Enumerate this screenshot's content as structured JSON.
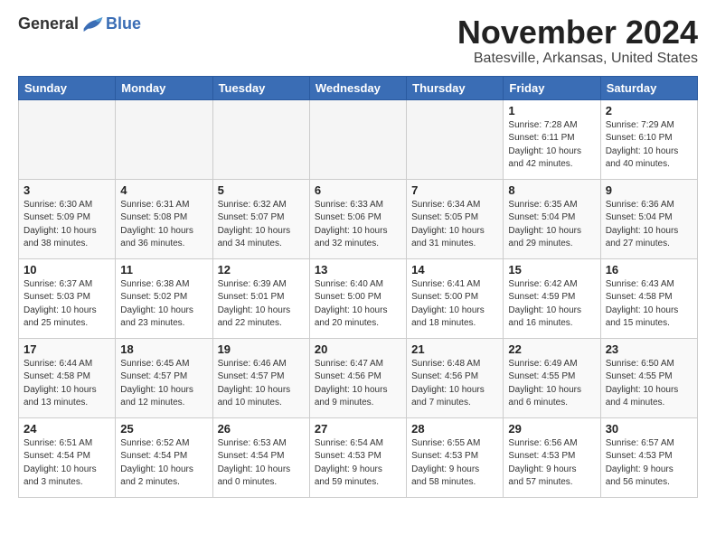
{
  "header": {
    "logo_general": "General",
    "logo_blue": "Blue",
    "month_title": "November 2024",
    "location": "Batesville, Arkansas, United States"
  },
  "days_of_week": [
    "Sunday",
    "Monday",
    "Tuesday",
    "Wednesday",
    "Thursday",
    "Friday",
    "Saturday"
  ],
  "weeks": [
    [
      {
        "day": "",
        "info": "",
        "empty": true
      },
      {
        "day": "",
        "info": "",
        "empty": true
      },
      {
        "day": "",
        "info": "",
        "empty": true
      },
      {
        "day": "",
        "info": "",
        "empty": true
      },
      {
        "day": "",
        "info": "",
        "empty": true
      },
      {
        "day": "1",
        "info": "Sunrise: 7:28 AM\nSunset: 6:11 PM\nDaylight: 10 hours\nand 42 minutes."
      },
      {
        "day": "2",
        "info": "Sunrise: 7:29 AM\nSunset: 6:10 PM\nDaylight: 10 hours\nand 40 minutes."
      }
    ],
    [
      {
        "day": "3",
        "info": "Sunrise: 6:30 AM\nSunset: 5:09 PM\nDaylight: 10 hours\nand 38 minutes."
      },
      {
        "day": "4",
        "info": "Sunrise: 6:31 AM\nSunset: 5:08 PM\nDaylight: 10 hours\nand 36 minutes."
      },
      {
        "day": "5",
        "info": "Sunrise: 6:32 AM\nSunset: 5:07 PM\nDaylight: 10 hours\nand 34 minutes."
      },
      {
        "day": "6",
        "info": "Sunrise: 6:33 AM\nSunset: 5:06 PM\nDaylight: 10 hours\nand 32 minutes."
      },
      {
        "day": "7",
        "info": "Sunrise: 6:34 AM\nSunset: 5:05 PM\nDaylight: 10 hours\nand 31 minutes."
      },
      {
        "day": "8",
        "info": "Sunrise: 6:35 AM\nSunset: 5:04 PM\nDaylight: 10 hours\nand 29 minutes."
      },
      {
        "day": "9",
        "info": "Sunrise: 6:36 AM\nSunset: 5:04 PM\nDaylight: 10 hours\nand 27 minutes."
      }
    ],
    [
      {
        "day": "10",
        "info": "Sunrise: 6:37 AM\nSunset: 5:03 PM\nDaylight: 10 hours\nand 25 minutes."
      },
      {
        "day": "11",
        "info": "Sunrise: 6:38 AM\nSunset: 5:02 PM\nDaylight: 10 hours\nand 23 minutes."
      },
      {
        "day": "12",
        "info": "Sunrise: 6:39 AM\nSunset: 5:01 PM\nDaylight: 10 hours\nand 22 minutes."
      },
      {
        "day": "13",
        "info": "Sunrise: 6:40 AM\nSunset: 5:00 PM\nDaylight: 10 hours\nand 20 minutes."
      },
      {
        "day": "14",
        "info": "Sunrise: 6:41 AM\nSunset: 5:00 PM\nDaylight: 10 hours\nand 18 minutes."
      },
      {
        "day": "15",
        "info": "Sunrise: 6:42 AM\nSunset: 4:59 PM\nDaylight: 10 hours\nand 16 minutes."
      },
      {
        "day": "16",
        "info": "Sunrise: 6:43 AM\nSunset: 4:58 PM\nDaylight: 10 hours\nand 15 minutes."
      }
    ],
    [
      {
        "day": "17",
        "info": "Sunrise: 6:44 AM\nSunset: 4:58 PM\nDaylight: 10 hours\nand 13 minutes."
      },
      {
        "day": "18",
        "info": "Sunrise: 6:45 AM\nSunset: 4:57 PM\nDaylight: 10 hours\nand 12 minutes."
      },
      {
        "day": "19",
        "info": "Sunrise: 6:46 AM\nSunset: 4:57 PM\nDaylight: 10 hours\nand 10 minutes."
      },
      {
        "day": "20",
        "info": "Sunrise: 6:47 AM\nSunset: 4:56 PM\nDaylight: 10 hours\nand 9 minutes."
      },
      {
        "day": "21",
        "info": "Sunrise: 6:48 AM\nSunset: 4:56 PM\nDaylight: 10 hours\nand 7 minutes."
      },
      {
        "day": "22",
        "info": "Sunrise: 6:49 AM\nSunset: 4:55 PM\nDaylight: 10 hours\nand 6 minutes."
      },
      {
        "day": "23",
        "info": "Sunrise: 6:50 AM\nSunset: 4:55 PM\nDaylight: 10 hours\nand 4 minutes."
      }
    ],
    [
      {
        "day": "24",
        "info": "Sunrise: 6:51 AM\nSunset: 4:54 PM\nDaylight: 10 hours\nand 3 minutes."
      },
      {
        "day": "25",
        "info": "Sunrise: 6:52 AM\nSunset: 4:54 PM\nDaylight: 10 hours\nand 2 minutes."
      },
      {
        "day": "26",
        "info": "Sunrise: 6:53 AM\nSunset: 4:54 PM\nDaylight: 10 hours\nand 0 minutes."
      },
      {
        "day": "27",
        "info": "Sunrise: 6:54 AM\nSunset: 4:53 PM\nDaylight: 9 hours\nand 59 minutes."
      },
      {
        "day": "28",
        "info": "Sunrise: 6:55 AM\nSunset: 4:53 PM\nDaylight: 9 hours\nand 58 minutes."
      },
      {
        "day": "29",
        "info": "Sunrise: 6:56 AM\nSunset: 4:53 PM\nDaylight: 9 hours\nand 57 minutes."
      },
      {
        "day": "30",
        "info": "Sunrise: 6:57 AM\nSunset: 4:53 PM\nDaylight: 9 hours\nand 56 minutes."
      }
    ]
  ]
}
